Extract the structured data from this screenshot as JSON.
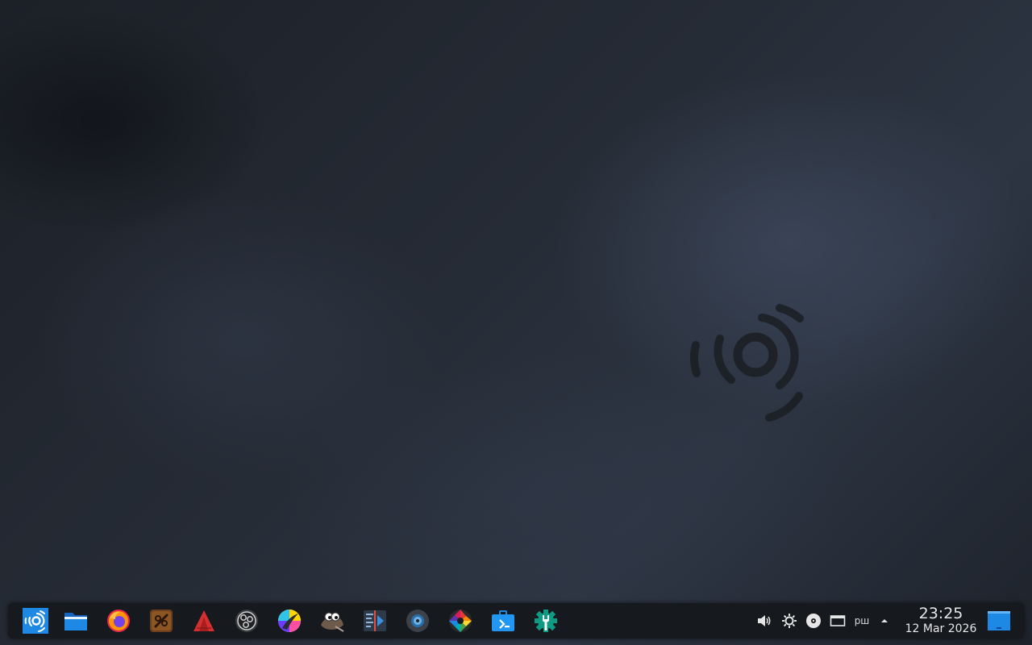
{
  "desktop": {
    "wallpaper_logo": "ubuntu-studio-logo"
  },
  "taskbar": {
    "launchers": [
      {
        "name": "app-menu",
        "icon": "ubuntu-studio-icon"
      },
      {
        "name": "file-manager",
        "icon": "folder-icon"
      },
      {
        "name": "firefox",
        "icon": "firefox-icon"
      },
      {
        "name": "app-brown",
        "icon": "audio-app-icon"
      },
      {
        "name": "app-red",
        "icon": "red-triangle-icon"
      },
      {
        "name": "obs",
        "icon": "obs-icon"
      },
      {
        "name": "krita",
        "icon": "krita-icon"
      },
      {
        "name": "gimp",
        "icon": "gimp-icon"
      },
      {
        "name": "kdenlive",
        "icon": "kdenlive-icon"
      },
      {
        "name": "app-circle",
        "icon": "circle-app-icon"
      },
      {
        "name": "darktable",
        "icon": "aperture-icon"
      },
      {
        "name": "software-center",
        "icon": "briefcase-icon"
      },
      {
        "name": "settings",
        "icon": "settings-icon"
      }
    ]
  },
  "tray": {
    "keyboard_layout": "рш",
    "icons": [
      "volume-icon",
      "brightness-icon",
      "disc-icon",
      "display-icon",
      "keyboard-layout-icon",
      "expand-tray-icon"
    ]
  },
  "clock": {
    "time": "23:25",
    "date": "12 Mar 2026"
  },
  "colors": {
    "panel": "#16191e",
    "accent_blue": "#1e88e5",
    "settings_teal": "#0f9a83"
  }
}
